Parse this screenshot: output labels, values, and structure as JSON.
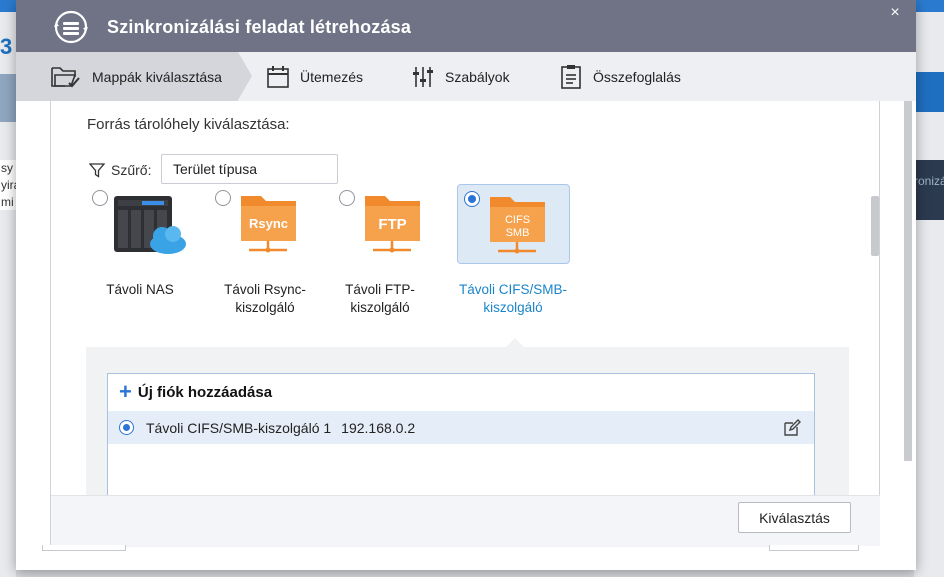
{
  "window": {
    "title": "Szinkronizálási feladat létrehozása",
    "close_icon": "×"
  },
  "steps": [
    {
      "label": "Mappák kiválasztása",
      "icon": "folder-check-icon",
      "active": true
    },
    {
      "label": "Ütemezés",
      "icon": "calendar-icon"
    },
    {
      "label": "Szabályok",
      "icon": "sliders-icon"
    },
    {
      "label": "Összefoglalás",
      "icon": "clipboard-icon"
    }
  ],
  "main": {
    "section_title": "Forrás tárolóhely kiválasztása:",
    "filter": {
      "label": "Szűrő:",
      "value": "Terület típusa"
    },
    "options": [
      {
        "label": "Távoli NAS",
        "icon": "nas-cloud-icon",
        "selected": false
      },
      {
        "label": "Távoli Rsync-kiszolgáló",
        "icon_text": "Rsync",
        "selected": false
      },
      {
        "label": "Távoli FTP-kiszolgáló",
        "icon_text": "FTP",
        "selected": false
      },
      {
        "label": "Távoli CIFS/SMB-kiszolgáló",
        "icon_text_1": "CIFS",
        "icon_text_2": "SMB",
        "selected": true
      }
    ],
    "account_list": {
      "add_label": "Új fiók hozzáadása",
      "items": [
        {
          "name": "Távoli CIFS/SMB-kiszolgáló 1",
          "ip": "192.168.0.2",
          "selected": true
        }
      ]
    }
  },
  "footer": {
    "select_button": "Kiválasztás"
  },
  "colors": {
    "titlebar": "#6f7385",
    "accent": "#2b73d6",
    "folder_orange": "#f08a2c",
    "selected_label": "#1a84c9"
  },
  "background": {
    "left_digit": "3",
    "left_text": "sy\nyira\nmi",
    "right_text": "ronizá"
  }
}
